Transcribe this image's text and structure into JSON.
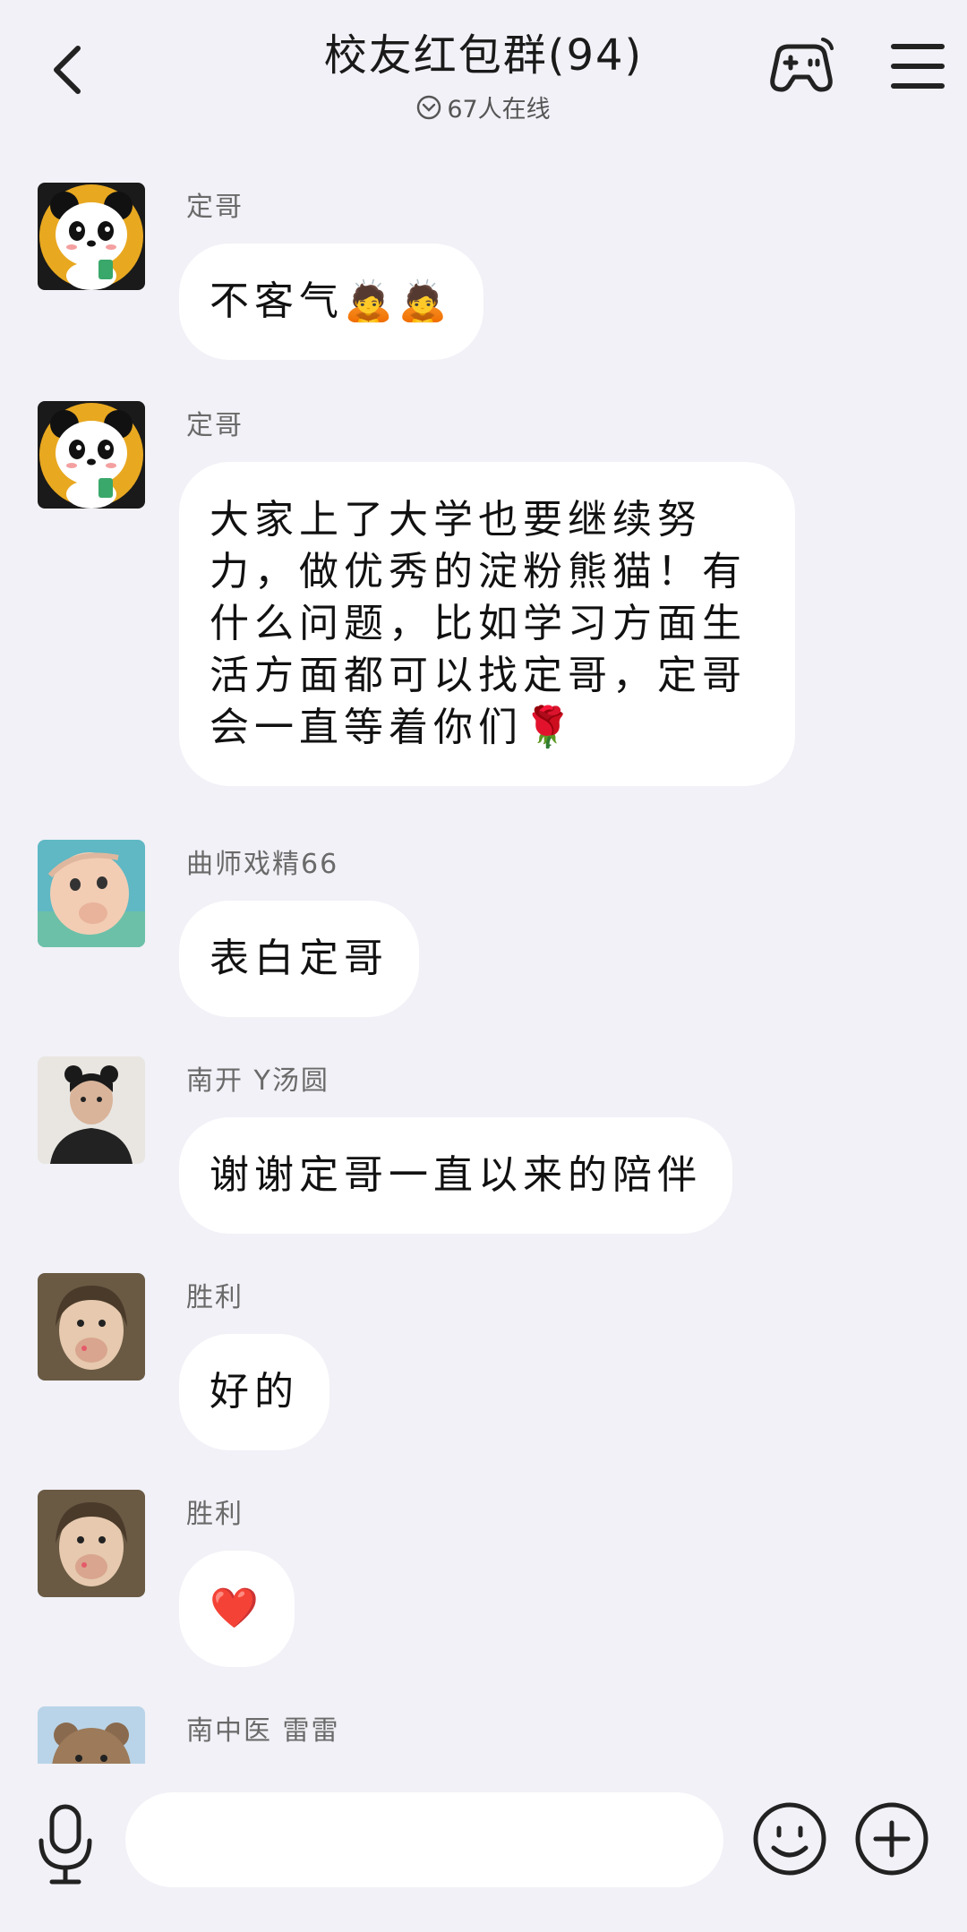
{
  "header": {
    "title": "校友红包群(94)",
    "online": "67人在线"
  },
  "messages": [
    {
      "sender": "定哥",
      "text": "不客气🙇🙇",
      "avatar": "panda-avatar"
    },
    {
      "sender": "定哥",
      "text": "大家上了大学也要继续努力，做优秀的淀粉熊猫！有什么问题，比如学习方面生活方面都可以找定哥，定哥会一直等着你们🌹",
      "avatar": "panda-avatar"
    },
    {
      "sender": "曲师戏精66",
      "text": "表白定哥",
      "avatar": "baby-avatar"
    },
    {
      "sender": "南开 Y汤圆",
      "text": "谢谢定哥一直以来的陪伴",
      "avatar": "girl-avatar"
    },
    {
      "sender": "胜利",
      "text": "好的",
      "avatar": "child-avatar"
    },
    {
      "sender": "胜利",
      "text": "❤️",
      "avatar": "child-avatar"
    },
    {
      "sender": "南中医 雷雷",
      "text": "",
      "avatar": "bear-avatar"
    }
  ],
  "input": {
    "placeholder": ""
  },
  "colors": {
    "background": "#f1f1f7",
    "bubble": "#ffffff"
  }
}
